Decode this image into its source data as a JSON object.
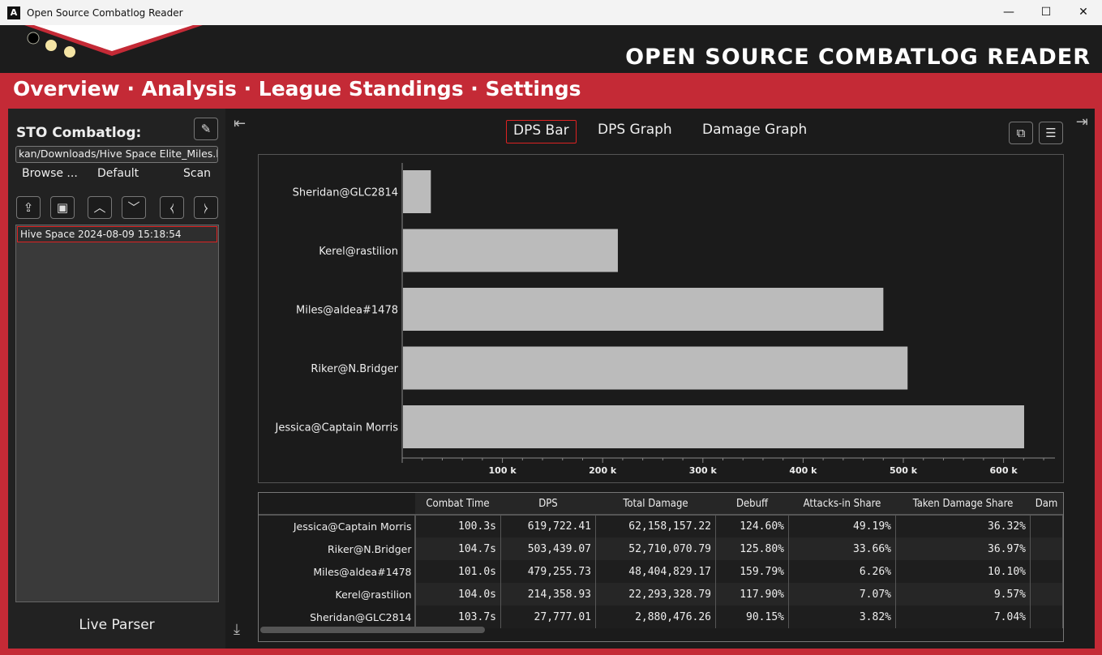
{
  "window": {
    "title": "Open Source Combatlog Reader",
    "minimize": "—",
    "maximize": "☐",
    "close": "✕"
  },
  "header": {
    "title": "OPEN SOURCE COMBATLOG READER"
  },
  "nav": {
    "items": [
      "Overview",
      "Analysis",
      "League Standings",
      "Settings"
    ],
    "separator": " · "
  },
  "sidebar": {
    "title": "STO Combatlog:",
    "path": "kan/Downloads/Hive Space Elite_Miles.log",
    "browse": "Browse ...",
    "default": "Default",
    "scan": "Scan",
    "combats": [
      "Hive Space 2024-08-09 15:18:54"
    ],
    "live_parser": "Live Parser"
  },
  "tabs": [
    "DPS Bar",
    "DPS Graph",
    "Damage Graph"
  ],
  "active_tab": "DPS Bar",
  "colors": {
    "accent": "#c42a36",
    "bar": "#bbbbbb"
  },
  "chart_data": {
    "type": "bar",
    "orientation": "horizontal",
    "categories": [
      "Sheridan@GLC2814",
      "Kerel@rastilion",
      "Miles@aldea#1478",
      "Riker@N.Bridger",
      "Jessica@Captain Morris"
    ],
    "values": [
      27777.01,
      214358.93,
      479255.73,
      503439.07,
      619722.41
    ],
    "xticks": [
      "100 k",
      "200 k",
      "300 k",
      "400 k",
      "500 k",
      "600 k"
    ],
    "xlim": [
      0,
      650000
    ]
  },
  "table": {
    "columns": [
      "Combat Time",
      "DPS",
      "Total Damage",
      "Debuff",
      "Attacks-in Share",
      "Taken Damage Share",
      "Dam"
    ],
    "rows": [
      {
        "name": "Jessica@Captain Morris",
        "cells": [
          "100.3s",
          "619,722.41",
          "62,158,157.22",
          "124.60%",
          "49.19%",
          "36.32%",
          ""
        ]
      },
      {
        "name": "Riker@N.Bridger",
        "cells": [
          "104.7s",
          "503,439.07",
          "52,710,070.79",
          "125.80%",
          "33.66%",
          "36.97%",
          ""
        ]
      },
      {
        "name": "Miles@aldea#1478",
        "cells": [
          "101.0s",
          "479,255.73",
          "48,404,829.17",
          "159.79%",
          "6.26%",
          "10.10%",
          ""
        ]
      },
      {
        "name": "Kerel@rastilion",
        "cells": [
          "104.0s",
          "214,358.93",
          "22,293,328.79",
          "117.90%",
          "7.07%",
          "9.57%",
          ""
        ]
      },
      {
        "name": "Sheridan@GLC2814",
        "cells": [
          "103.7s",
          "27,777.01",
          "2,880,476.26",
          "90.15%",
          "3.82%",
          "7.04%",
          ""
        ]
      }
    ]
  }
}
